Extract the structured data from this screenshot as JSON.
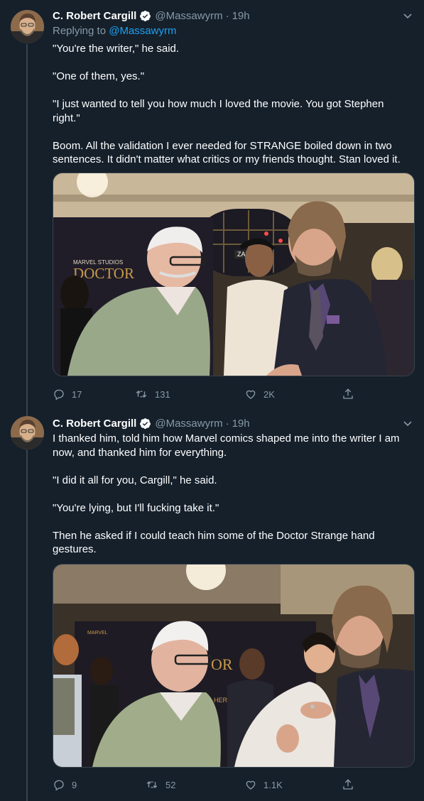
{
  "tweets": [
    {
      "author_name": "C. Robert Cargill",
      "handle": "@Massawyrm",
      "separator": "·",
      "time": "19h",
      "reply_prefix": "Replying to",
      "reply_to": "@Massawyrm",
      "paragraphs": [
        "\"You're the writer,\" he said.",
        "\"One of them, yes.\"",
        "\"I just wanted to tell you how much I loved the movie. You got Stephen right.\"",
        "Boom. All the validation I ever needed for STRANGE boiled down in two sentences. It didn't matter what critics or my friends thought. Stan loved it."
      ],
      "photo_sign_text": [
        "MARVEL STUDIOS",
        "DOCTOR",
        "ZARA"
      ],
      "replies": "17",
      "retweets": "131",
      "likes": "2K"
    },
    {
      "author_name": "C. Robert Cargill",
      "handle": "@Massawyrm",
      "separator": "·",
      "time": "19h",
      "paragraphs": [
        "I thanked him, told him how Marvel comics shaped me into the writer I am now, and thanked him for everything.",
        "\"I did it all for you, Cargill,\" he said.",
        "\"You're lying, but I'll fucking take it.\"",
        "Then he asked if I could teach him some of the Doctor Strange hand gestures."
      ],
      "photo_sign_text": [
        "OR",
        "HER"
      ],
      "replies": "9",
      "retweets": "52",
      "likes": "1.1K"
    }
  ],
  "colors": {
    "background": "#15202b",
    "secondary_text": "#8899a6",
    "link": "#1da1f2",
    "divider": "#38444d"
  },
  "icons": [
    "verified-badge-icon",
    "chevron-down-icon",
    "reply-icon",
    "retweet-icon",
    "like-icon",
    "share-icon"
  ]
}
